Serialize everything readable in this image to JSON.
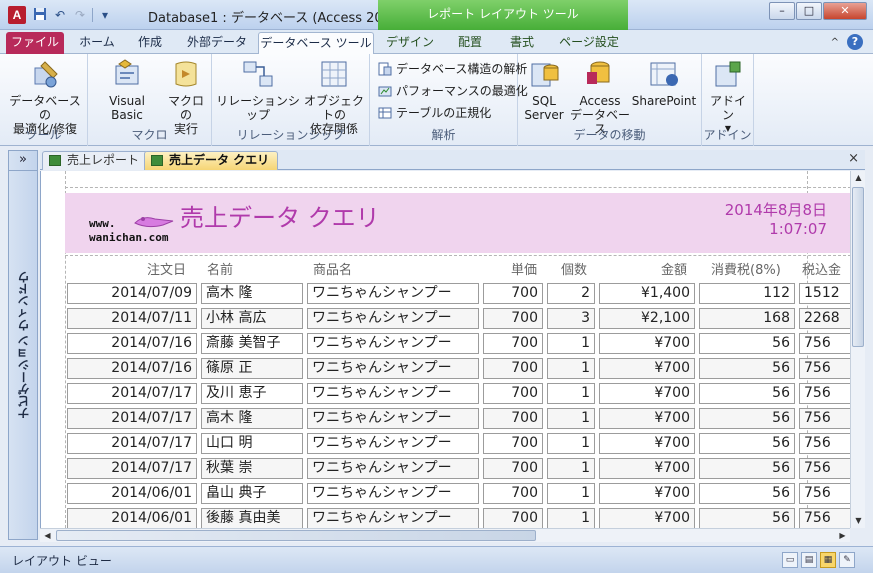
{
  "titlebar": {
    "app_icon": "A",
    "doc_title": "Database1 : データベース (Access 200...",
    "context_group": "レポート レイアウト ツール",
    "minimize": "–",
    "restore": "□",
    "close": "✕",
    "qat": {
      "save_icon": "💾",
      "undo_icon": "↶",
      "redo_icon": "↷",
      "customize_icon": "▾"
    }
  },
  "tabs": {
    "file": "ファイル",
    "home": "ホーム",
    "create": "作成",
    "external": "外部データ",
    "db_tools": "データベース ツール",
    "design": "デザイン",
    "arrange": "配置",
    "format": "書式",
    "page_setup": "ページ設定",
    "help": "?",
    "collapse": "^"
  },
  "ribbon": {
    "tools_group": "ツール",
    "compact_repair": "データベースの\n最適化/修復",
    "macro_group": "マクロ",
    "visual_basic": "Visual Basic",
    "run_macro": "マクロの\n実行",
    "relationships_group": "リレーションシップ",
    "relationships": "リレーションシップ",
    "object_dependencies": "オブジェクトの\n依存関係",
    "analyze_group": "解析",
    "db_documenter": "データベース構造の解析",
    "analyze_performance": "パフォーマンスの最適化",
    "analyze_table": "テーブルの正規化",
    "move_data_group": "データの移動",
    "sql_server": "SQL\nServer",
    "access_db": "Access\nデータベース",
    "sharepoint": "SharePoint",
    "addins_group": "アドイン",
    "addins": "アドイン"
  },
  "nav": {
    "toggle": "»",
    "label": "ナビゲーション ウィンドウ"
  },
  "doc_tabs": [
    {
      "label": "売上レポート"
    },
    {
      "label": "売上データ クエリ"
    }
  ],
  "doc_close": "×",
  "report": {
    "logo_line1": "www.",
    "logo_line2": "wanichan.com",
    "title": "売上データ クエリ",
    "date": "2014年8月8日",
    "time": "1:07:07",
    "columns": [
      "注文日",
      "名前",
      "商品名",
      "単価",
      "個数",
      "金額",
      "消費税(8%)",
      "税込金"
    ],
    "rows": [
      [
        "2014/07/09",
        "高木 隆",
        "ワニちゃんシャンプー",
        "700",
        "2",
        "¥1,400",
        "112",
        "1512"
      ],
      [
        "2014/07/11",
        "小林 高広",
        "ワニちゃんシャンプー",
        "700",
        "3",
        "¥2,100",
        "168",
        "2268"
      ],
      [
        "2014/07/16",
        "斎藤 美智子",
        "ワニちゃんシャンプー",
        "700",
        "1",
        "¥700",
        "56",
        "756"
      ],
      [
        "2014/07/16",
        "篠原 正",
        "ワニちゃんシャンプー",
        "700",
        "1",
        "¥700",
        "56",
        "756"
      ],
      [
        "2014/07/17",
        "及川 恵子",
        "ワニちゃんシャンプー",
        "700",
        "1",
        "¥700",
        "56",
        "756"
      ],
      [
        "2014/07/17",
        "高木 隆",
        "ワニちゃんシャンプー",
        "700",
        "1",
        "¥700",
        "56",
        "756"
      ],
      [
        "2014/07/17",
        "山口 明",
        "ワニちゃんシャンプー",
        "700",
        "1",
        "¥700",
        "56",
        "756"
      ],
      [
        "2014/07/17",
        "秋葉 崇",
        "ワニちゃんシャンプー",
        "700",
        "1",
        "¥700",
        "56",
        "756"
      ],
      [
        "2014/06/01",
        "畠山 典子",
        "ワニちゃんシャンプー",
        "700",
        "1",
        "¥700",
        "56",
        "756"
      ],
      [
        "2014/06/01",
        "後藤 真由美",
        "ワニちゃんシャンプー",
        "700",
        "1",
        "¥700",
        "56",
        "756"
      ]
    ]
  },
  "status": {
    "text": "レイアウト ビュー",
    "view_icons": [
      "report-view-icon",
      "print-preview-icon",
      "layout-view-icon",
      "design-view-icon"
    ]
  },
  "colors": {
    "accent": "#b82a5a",
    "header_bg": "#f0d4ee",
    "title_text": "#b03aab",
    "context_green": "#47ae38"
  }
}
